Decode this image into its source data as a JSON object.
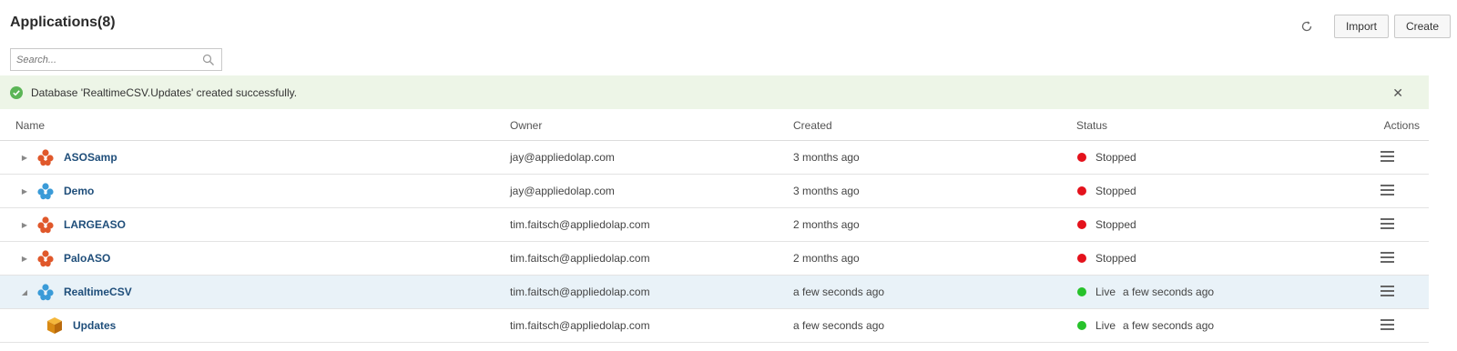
{
  "header": {
    "title": "Applications(8)",
    "import_label": "Import",
    "create_label": "Create"
  },
  "search": {
    "placeholder": "Search..."
  },
  "banner": {
    "message": "Database 'RealtimeCSV.Updates' created successfully.",
    "close_glyph": "✕"
  },
  "table": {
    "columns": {
      "name": "Name",
      "owner": "Owner",
      "created": "Created",
      "status": "Status",
      "actions": "Actions"
    },
    "rows": [
      {
        "name": "ASOSamp",
        "owner": "jay@appliedolap.com",
        "created": "3 months ago",
        "status": "Stopped",
        "status_extra": "",
        "icon": "aso-app-icon",
        "icon_color": "#e0582b"
      },
      {
        "name": "Demo",
        "owner": "jay@appliedolap.com",
        "created": "3 months ago",
        "status": "Stopped",
        "status_extra": "",
        "icon": "bso-app-icon",
        "icon_color": "#3a9bd8"
      },
      {
        "name": "LARGEASO",
        "owner": "tim.faitsch@appliedolap.com",
        "created": "2 months ago",
        "status": "Stopped",
        "status_extra": "",
        "icon": "aso-app-icon",
        "icon_color": "#e0582b"
      },
      {
        "name": "PaloASO",
        "owner": "tim.faitsch@appliedolap.com",
        "created": "2 months ago",
        "status": "Stopped",
        "status_extra": "",
        "icon": "aso-app-icon",
        "icon_color": "#e0582b"
      },
      {
        "name": "RealtimeCSV",
        "owner": "tim.faitsch@appliedolap.com",
        "created": "a few seconds ago",
        "status": "Live",
        "status_extra": "a few seconds ago",
        "icon": "bso-app-icon",
        "icon_color": "#3a9bd8"
      },
      {
        "name": "Updates",
        "owner": "tim.faitsch@appliedolap.com",
        "created": "a few seconds ago",
        "status": "Live",
        "status_extra": "a few seconds ago",
        "icon": "cube-icon",
        "icon_color": "#e8a020"
      }
    ]
  },
  "colors": {
    "stopped": "#e4121c",
    "live": "#27c22b",
    "banner_bg": "#edf5e7",
    "selected_row": "#e9f2f8",
    "link": "#1f4e7a"
  }
}
